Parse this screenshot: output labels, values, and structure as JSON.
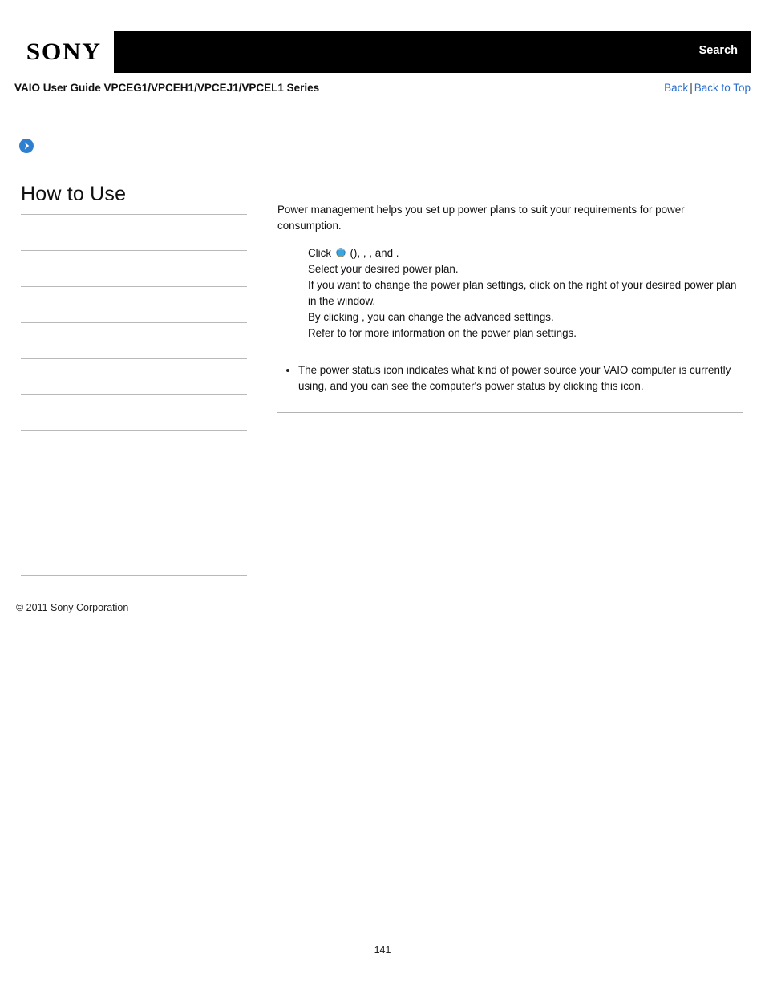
{
  "header": {
    "logo_text": "SONY",
    "search_label": "Search"
  },
  "subheader": {
    "guide_title": "VAIO User Guide VPCEG1/VPCEH1/VPCEJ1/VPCEL1 Series",
    "back_label": "Back",
    "separator": "|",
    "back_to_top_label": "Back to Top"
  },
  "sidebar": {
    "heading": "How to Use",
    "items": [
      {
        "label": ""
      },
      {
        "label": ""
      },
      {
        "label": ""
      },
      {
        "label": ""
      },
      {
        "label": ""
      },
      {
        "label": ""
      },
      {
        "label": ""
      },
      {
        "label": ""
      },
      {
        "label": ""
      },
      {
        "label": ""
      }
    ],
    "copyright": "© 2011 Sony Corporation"
  },
  "content": {
    "intro": "Power management helps you set up power plans to suit your requirements for power consumption.",
    "steps": [
      {
        "prefix": "Click ",
        "icon": "internet-explorer-icon",
        "open_paren": " (",
        "link1": "",
        "close_paren": "), ",
        "link2": "",
        "comma1": ", ",
        "link3": "",
        "tail": ", and ",
        "link4": "",
        "period": "."
      },
      {
        "text": "Select your desired power plan."
      },
      {
        "prefix": "If you want to change the power plan settings, click ",
        "link1": "",
        "mid": " on the right of your desired power plan in the ",
        "link2": "",
        "tail": " window."
      },
      {
        "prefix": "By clicking ",
        "link1": "",
        "tail": ", you can change the advanced settings."
      },
      {
        "prefix": "Refer to ",
        "link1": "",
        "tail": " for more information on the power plan settings."
      }
    ],
    "notes": [
      "The power status icon indicates what kind of power source your VAIO computer is currently using, and you can see the computer's power status by clicking this icon."
    ]
  },
  "footer": {
    "page_number": "141"
  }
}
